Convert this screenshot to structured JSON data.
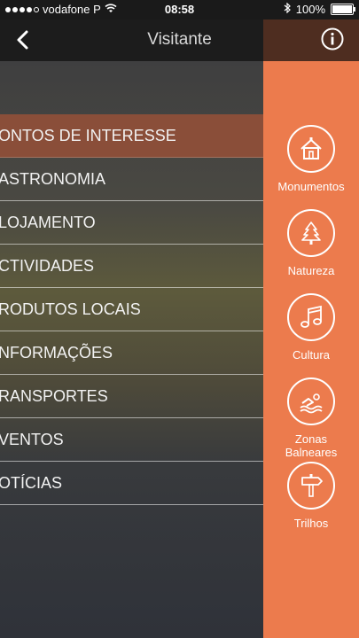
{
  "status_bar": {
    "carrier": "vodafone P",
    "time": "08:58",
    "battery": "100%"
  },
  "header": {
    "title": "Visitante",
    "back_icon": "chevron-left-icon",
    "info_icon": "info-circle-icon"
  },
  "menu": {
    "items": [
      {
        "label": "ONTOS DE INTERESSE",
        "active": true
      },
      {
        "label": "ASTRONOMIA",
        "active": false
      },
      {
        "label": "LOJAMENTO",
        "active": false
      },
      {
        "label": "CTIVIDADES",
        "active": false
      },
      {
        "label": "RODUTOS LOCAIS",
        "active": false
      },
      {
        "label": "NFORMAÇÕES",
        "active": false
      },
      {
        "label": "RANSPORTES",
        "active": false
      },
      {
        "label": "VENTOS",
        "active": false
      },
      {
        "label": "OTÍCIAS",
        "active": false
      }
    ]
  },
  "categories": [
    {
      "label": "Monumentos",
      "icon": "house-icon"
    },
    {
      "label": "Natureza",
      "icon": "pine-tree-icon"
    },
    {
      "label": "Cultura",
      "icon": "music-note-icon"
    },
    {
      "label": "Zonas Balneares",
      "icon": "swimmer-icon"
    },
    {
      "label": "Trilhos",
      "icon": "signpost-icon"
    }
  ],
  "colors": {
    "accent": "#ec7b4d",
    "active_item": "#8a4e39",
    "header": "#1c1c1c"
  }
}
